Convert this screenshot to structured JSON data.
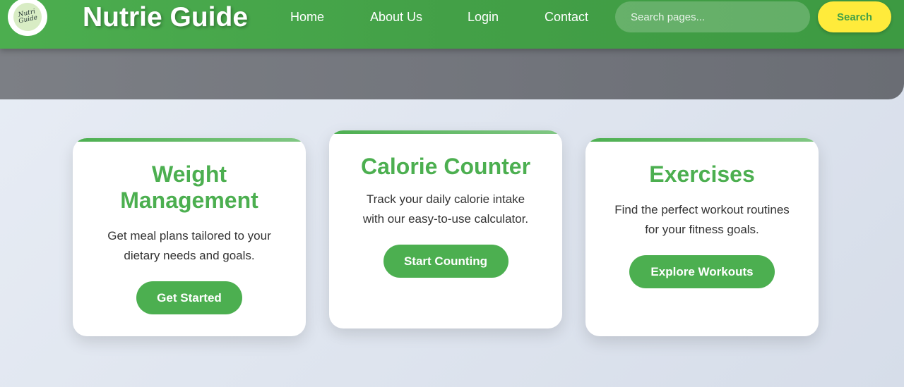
{
  "header": {
    "logo_text": "Nutri Guide",
    "brand": "Nutrie Guide",
    "nav": [
      "Home",
      "About Us",
      "Login",
      "Contact"
    ],
    "search_placeholder": "Search pages...",
    "search_button": "Search"
  },
  "cards": [
    {
      "title": "Weight Management",
      "text": "Get meal plans tailored to your dietary needs and goals.",
      "button": "Get Started"
    },
    {
      "title": "Calorie Counter",
      "text": "Track your daily calorie intake with our easy-to-use calculator.",
      "button": "Start Counting"
    },
    {
      "title": "Exercises",
      "text": "Find the perfect workout routines for your fitness goals.",
      "button": "Explore Workouts"
    }
  ],
  "colors": {
    "primary_green": "#4caf50",
    "header_green": "#43a047",
    "accent_yellow": "#ffeb3b",
    "banner_gray": "#75787e",
    "text_dark": "#333333"
  }
}
